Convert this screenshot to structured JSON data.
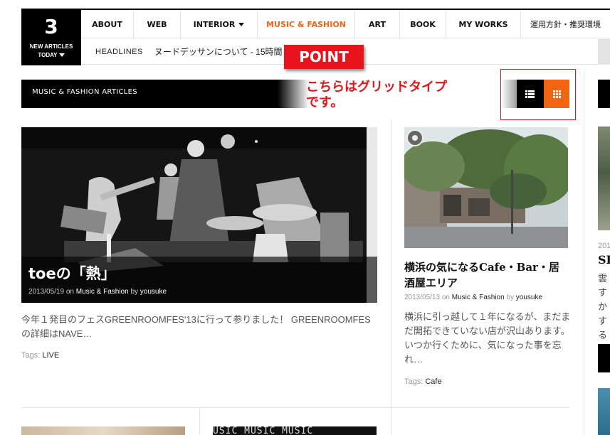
{
  "header": {
    "count": "3",
    "count_label_1": "NEW ARTICLES",
    "count_label_2": "TODAY",
    "nav": [
      {
        "label": "ABOUT"
      },
      {
        "label": "WEB"
      },
      {
        "label": "INTERIOR"
      },
      {
        "label": "MUSIC & FASHION"
      },
      {
        "label": "ART"
      },
      {
        "label": "BOOK"
      },
      {
        "label": "MY WORKS"
      },
      {
        "label": "運用方針・推奨環境"
      }
    ],
    "headlines_label": "HEADLINES",
    "headline_text": "ヌードデッサンについて - 15時間"
  },
  "section": {
    "title": "MUSIC & FASHION ARTICLES",
    "view_modes": [
      "list-icon",
      "grid-icon"
    ],
    "active_view": "grid"
  },
  "annotation": {
    "badge": "POINT",
    "callout": "こちらはグリッドタイプです。",
    "color": "#e8131b"
  },
  "articles": [
    {
      "title": "toeの「熱」",
      "date": "2013/05/19",
      "on": "on",
      "category": "Music & Fashion",
      "by": "by",
      "author": "yousuke",
      "excerpt": "今年１発目のフェスGREENROOMFES'13に行って参りました！ GREENROOMFESの詳細はNAVE…",
      "tags_label": "Tags:",
      "tag": "LIVE"
    },
    {
      "title": "横浜の気になるCafe・Bar・居酒屋エリア",
      "date": "2013/05/13",
      "on": "on",
      "category": "Music & Fashion",
      "by": "by",
      "author": "yousuke",
      "excerpt": "横浜に引っ越して１年になるが、まだまだ開拓できていない店が沢山あります。 いつか行くために、気になった事を忘れ…",
      "tags_label": "Tags:",
      "tag": "Cafe"
    }
  ],
  "sidebar": {
    "date": "201",
    "title": "SE",
    "excerpt": "雲すかする"
  },
  "bottom": {
    "music_strip": "USIC MUSIC MUSIC"
  },
  "colors": {
    "accent": "#f06414",
    "annotation": "#e8131b"
  }
}
